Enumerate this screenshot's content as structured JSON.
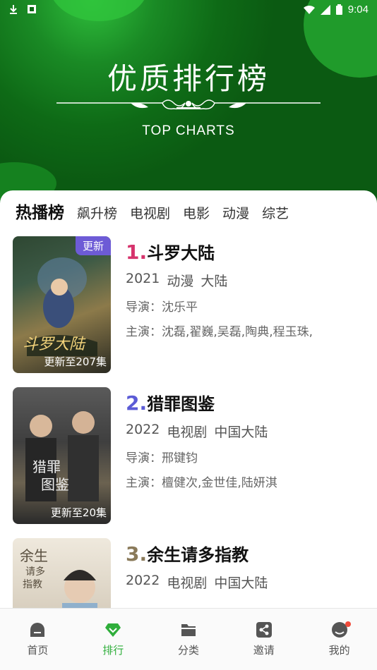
{
  "status_bar": {
    "time": "9:04"
  },
  "hero": {
    "title": "优质排行榜",
    "subtitle": "TOP CHARTS"
  },
  "tabs": [
    "热播榜",
    "飙升榜",
    "电视剧",
    "电影",
    "动漫",
    "综艺"
  ],
  "items": [
    {
      "rank": "1.",
      "rank_color": "#d6336c",
      "name": "斗罗大陆",
      "year": "2021",
      "genre": "动漫",
      "region": "大陆",
      "director": "导演：沈乐平",
      "cast": "主演：沈磊,翟巍,吴磊,陶典,程玉珠,",
      "badge": "更新",
      "update": "更新至207集",
      "poster_colors": [
        "#3e5c3a",
        "#a9894e",
        "#1f2f4a"
      ]
    },
    {
      "rank": "2.",
      "rank_color": "#5b5bd6",
      "name": "猎罪图鉴",
      "year": "2022",
      "genre": "电视剧",
      "region": "中国大陆",
      "director": "导演：邢键钧",
      "cast": "主演：檀健次,金世佳,陆妍淇",
      "update": "更新至20集",
      "poster_colors": [
        "#4a4a4a",
        "#6b6250",
        "#2a2a2a"
      ]
    },
    {
      "rank": "3.",
      "rank_color": "#8a7a5a",
      "name": "余生请多指教",
      "year": "2022",
      "genre": "电视剧",
      "region": "中国大陆",
      "poster_colors": [
        "#e8e2d6",
        "#cfc6b5",
        "#9db3c8"
      ]
    }
  ],
  "nav": [
    {
      "label": "首页",
      "icon": "home-icon"
    },
    {
      "label": "排行",
      "icon": "diamond-icon",
      "active": true
    },
    {
      "label": "分类",
      "icon": "folder-icon"
    },
    {
      "label": "邀请",
      "icon": "share-icon"
    },
    {
      "label": "我的",
      "icon": "profile-icon",
      "dot": true
    }
  ],
  "colors": {
    "accent": "#2fae3b",
    "header_green": "#0e6a16",
    "badge_purple": "#6d5bd6"
  }
}
